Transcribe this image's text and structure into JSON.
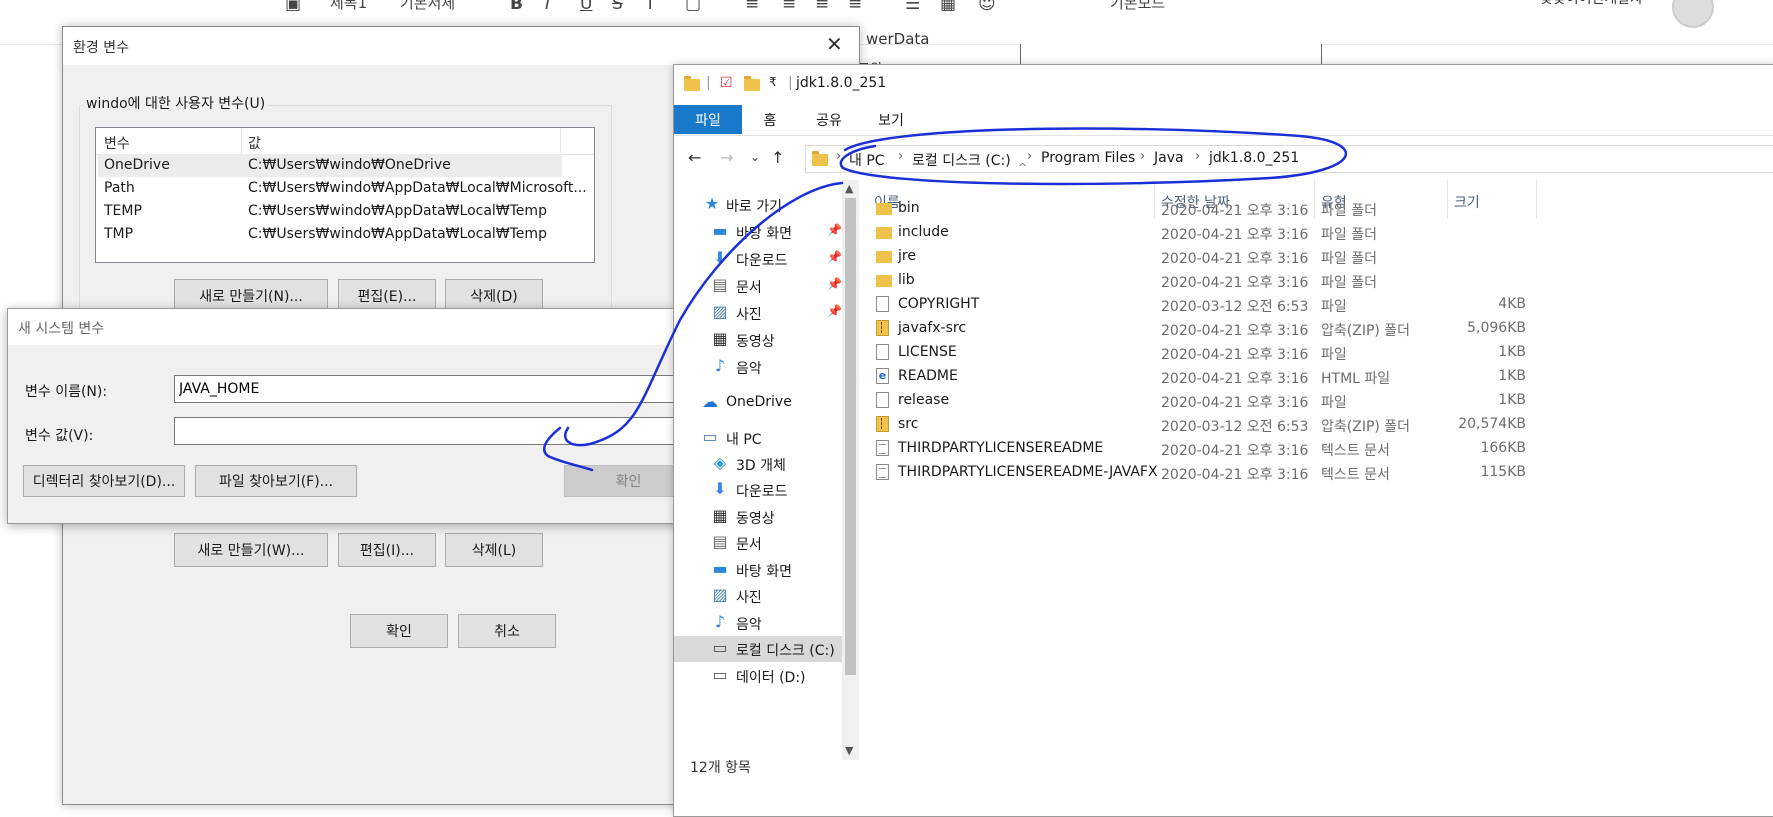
{
  "top_toolbar": {
    "items": [
      "제목1",
      "기본서체",
      "B",
      "I",
      "U",
      "S",
      "T",
      "기본모드"
    ],
    "profile_name": "꽃꽃이어린개발자",
    "background_text": [
      "werData",
      "로워"
    ]
  },
  "env_dialog": {
    "title": "환경 변수",
    "user_group_label": "windo에 대한 사용자 변수(U)",
    "columns": [
      "변수",
      "값"
    ],
    "rows": [
      {
        "name": "OneDrive",
        "value": "C:₩Users₩windo₩OneDrive"
      },
      {
        "name": "Path",
        "value": "C:₩Users₩windo₩AppData₩Local₩Microsoft..."
      },
      {
        "name": "TEMP",
        "value": "C:₩Users₩windo₩AppData₩Local₩Temp"
      },
      {
        "name": "TMP",
        "value": "C:₩Users₩windo₩AppData₩Local₩Temp"
      }
    ],
    "user_buttons": {
      "new": "새로 만들기(N)...",
      "edit": "편집(E)...",
      "delete": "삭제(D)"
    },
    "system_buttons": {
      "new": "새로 만들기(W)...",
      "edit": "편집(I)...",
      "delete": "삭제(L)"
    },
    "ok": "확인",
    "cancel": "취소"
  },
  "new_var_dialog": {
    "title": "새 시스템 변수",
    "name_label": "변수 이름(N):",
    "name_value": "JAVA_HOME",
    "value_label": "변수 값(V):",
    "value_value": "",
    "browse_dir": "디렉터리 찾아보기(D)...",
    "browse_file": "파일 찾아보기(F)...",
    "ok": "확인"
  },
  "explorer": {
    "title": "jdk1.8.0_251",
    "qat_dropdown": "₹",
    "ribbon_tabs": [
      "파일",
      "홈",
      "공유",
      "보기"
    ],
    "active_tab": "파일",
    "breadcrumb": [
      "내 PC",
      "로컬 디스크 (C:)",
      "Program Files",
      "Java",
      "jdk1.8.0_251"
    ],
    "nav_items": [
      {
        "label": "바로 가기",
        "icon": "star-icon",
        "pinned": false
      },
      {
        "label": "바탕 화면",
        "icon": "desktop-icon",
        "pinned": true
      },
      {
        "label": "다운로드",
        "icon": "download-icon",
        "pinned": true
      },
      {
        "label": "문서",
        "icon": "documents-icon",
        "pinned": true
      },
      {
        "label": "사진",
        "icon": "pictures-icon",
        "pinned": true
      },
      {
        "label": "동영상",
        "icon": "videos-icon",
        "pinned": false
      },
      {
        "label": "음악",
        "icon": "music-icon",
        "pinned": false
      },
      {
        "label": "OneDrive",
        "icon": "cloud-icon",
        "pinned": false
      },
      {
        "label": "내 PC",
        "icon": "pc-icon",
        "pinned": false
      },
      {
        "label": "3D 개체",
        "icon": "3d-objects-icon",
        "pinned": false
      },
      {
        "label": "다운로드",
        "icon": "download-icon",
        "pinned": false
      },
      {
        "label": "동영상",
        "icon": "videos-icon",
        "pinned": false
      },
      {
        "label": "문서",
        "icon": "documents-icon",
        "pinned": false
      },
      {
        "label": "바탕 화면",
        "icon": "desktop-icon",
        "pinned": false
      },
      {
        "label": "사진",
        "icon": "pictures-icon",
        "pinned": false
      },
      {
        "label": "음악",
        "icon": "music-icon",
        "pinned": false
      },
      {
        "label": "로컬 디스크 (C:)",
        "icon": "drive-icon",
        "pinned": false,
        "selected": true
      },
      {
        "label": "데이터 (D:)",
        "icon": "drive-icon",
        "pinned": false
      }
    ],
    "columns": [
      "이름",
      "수정한 날짜",
      "유형",
      "크기"
    ],
    "files": [
      {
        "name": "bin",
        "date": "2020-04-21 오후 3:16",
        "type": "파일 폴더",
        "size": "",
        "icon": "folder"
      },
      {
        "name": "include",
        "date": "2020-04-21 오후 3:16",
        "type": "파일 폴더",
        "size": "",
        "icon": "folder"
      },
      {
        "name": "jre",
        "date": "2020-04-21 오후 3:16",
        "type": "파일 폴더",
        "size": "",
        "icon": "folder"
      },
      {
        "name": "lib",
        "date": "2020-04-21 오후 3:16",
        "type": "파일 폴더",
        "size": "",
        "icon": "folder"
      },
      {
        "name": "COPYRIGHT",
        "date": "2020-03-12 오전 6:53",
        "type": "파일",
        "size": "4KB",
        "icon": "doc"
      },
      {
        "name": "javafx-src",
        "date": "2020-04-21 오후 3:16",
        "type": "압축(ZIP) 폴더",
        "size": "5,096KB",
        "icon": "zip"
      },
      {
        "name": "LICENSE",
        "date": "2020-04-21 오후 3:16",
        "type": "파일",
        "size": "1KB",
        "icon": "doc"
      },
      {
        "name": "README",
        "date": "2020-04-21 오후 3:16",
        "type": "HTML 파일",
        "size": "1KB",
        "icon": "html"
      },
      {
        "name": "release",
        "date": "2020-04-21 오후 3:16",
        "type": "파일",
        "size": "1KB",
        "icon": "doc"
      },
      {
        "name": "src",
        "date": "2020-03-12 오전 6:53",
        "type": "압축(ZIP) 폴더",
        "size": "20,574KB",
        "icon": "zip"
      },
      {
        "name": "THIRDPARTYLICENSEREADME",
        "date": "2020-04-21 오후 3:16",
        "type": "텍스트 문서",
        "size": "166KB",
        "icon": "txt"
      },
      {
        "name": "THIRDPARTYLICENSEREADME-JAVAFX",
        "date": "2020-04-21 오후 3:16",
        "type": "텍스트 문서",
        "size": "115KB",
        "icon": "txt"
      }
    ],
    "status": "12개 항목"
  },
  "colors": {
    "ribbon_accent": "#1979ca",
    "annotation_ink": "#1a2fd6",
    "dialog_bg": "#f0f0f0",
    "folder_yellow": "#f0c14b"
  }
}
